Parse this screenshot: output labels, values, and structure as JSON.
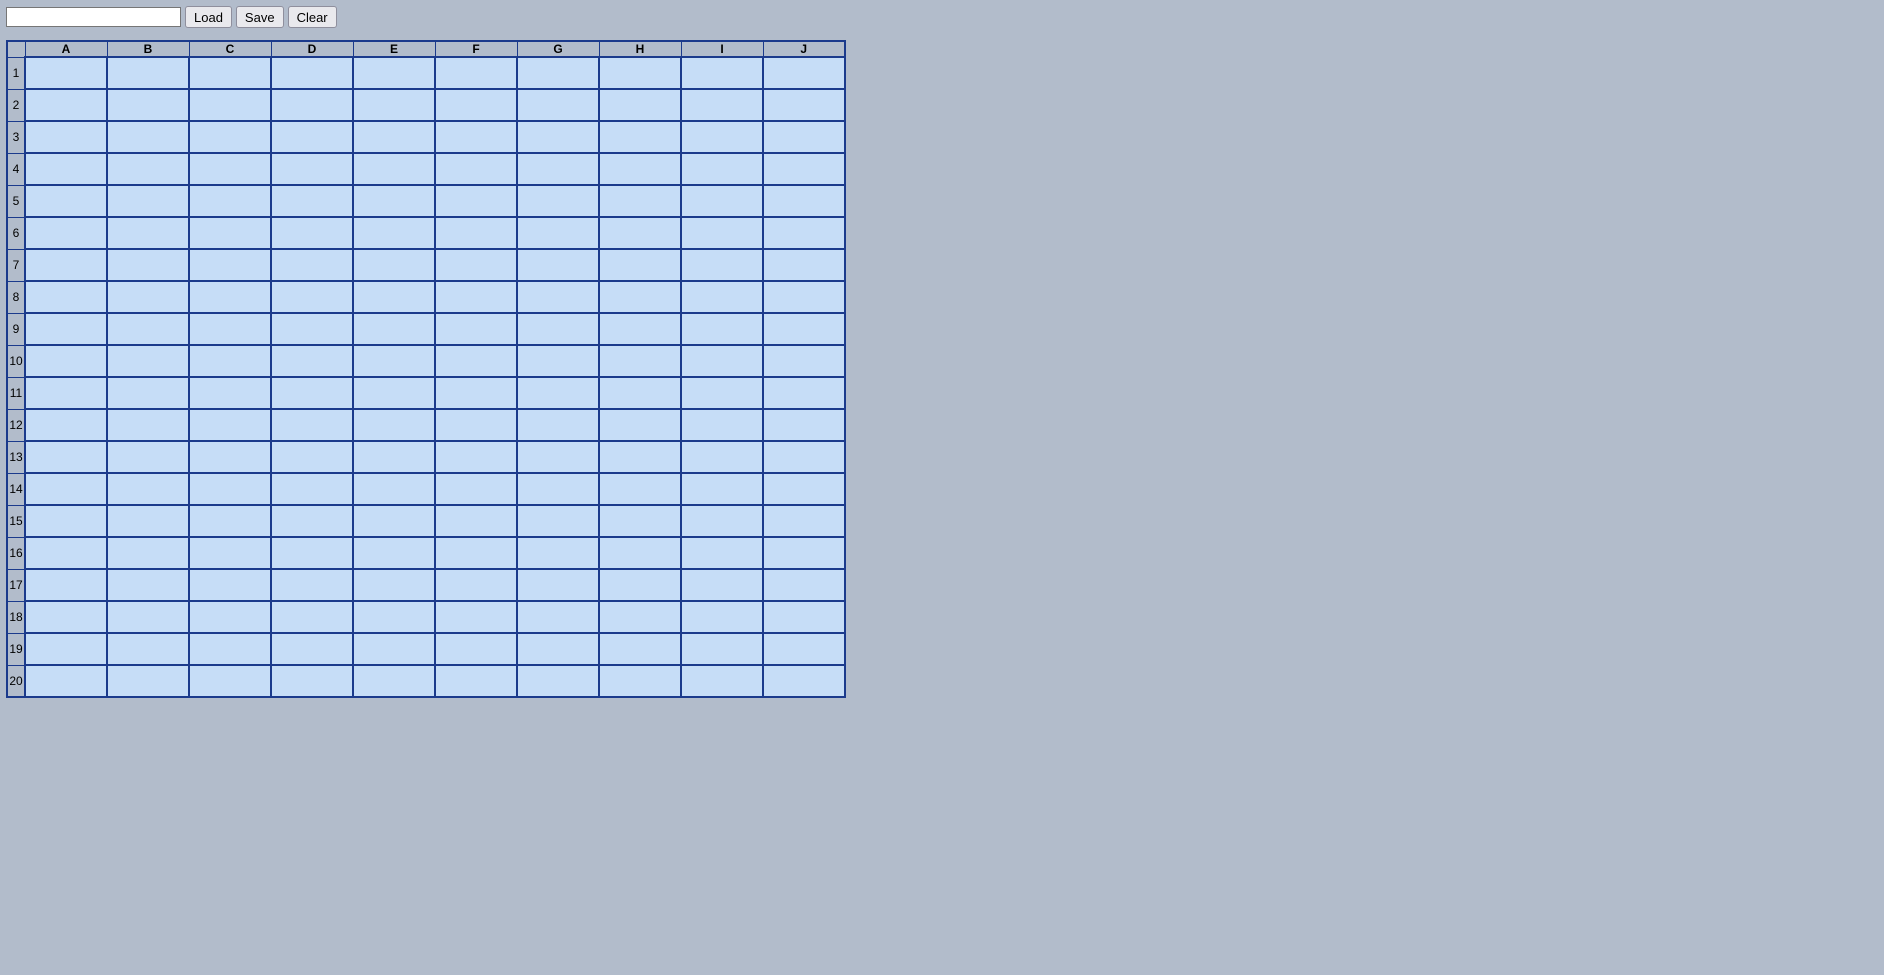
{
  "toolbar": {
    "input_value": "",
    "load_label": "Load",
    "save_label": "Save",
    "clear_label": "Clear"
  },
  "grid": {
    "columns": [
      "A",
      "B",
      "C",
      "D",
      "E",
      "F",
      "G",
      "H",
      "I",
      "J"
    ],
    "rows": [
      "1",
      "2",
      "3",
      "4",
      "5",
      "6",
      "7",
      "8",
      "9",
      "10",
      "11",
      "12",
      "13",
      "14",
      "15",
      "16",
      "17",
      "18",
      "19",
      "20"
    ],
    "cells": {}
  }
}
